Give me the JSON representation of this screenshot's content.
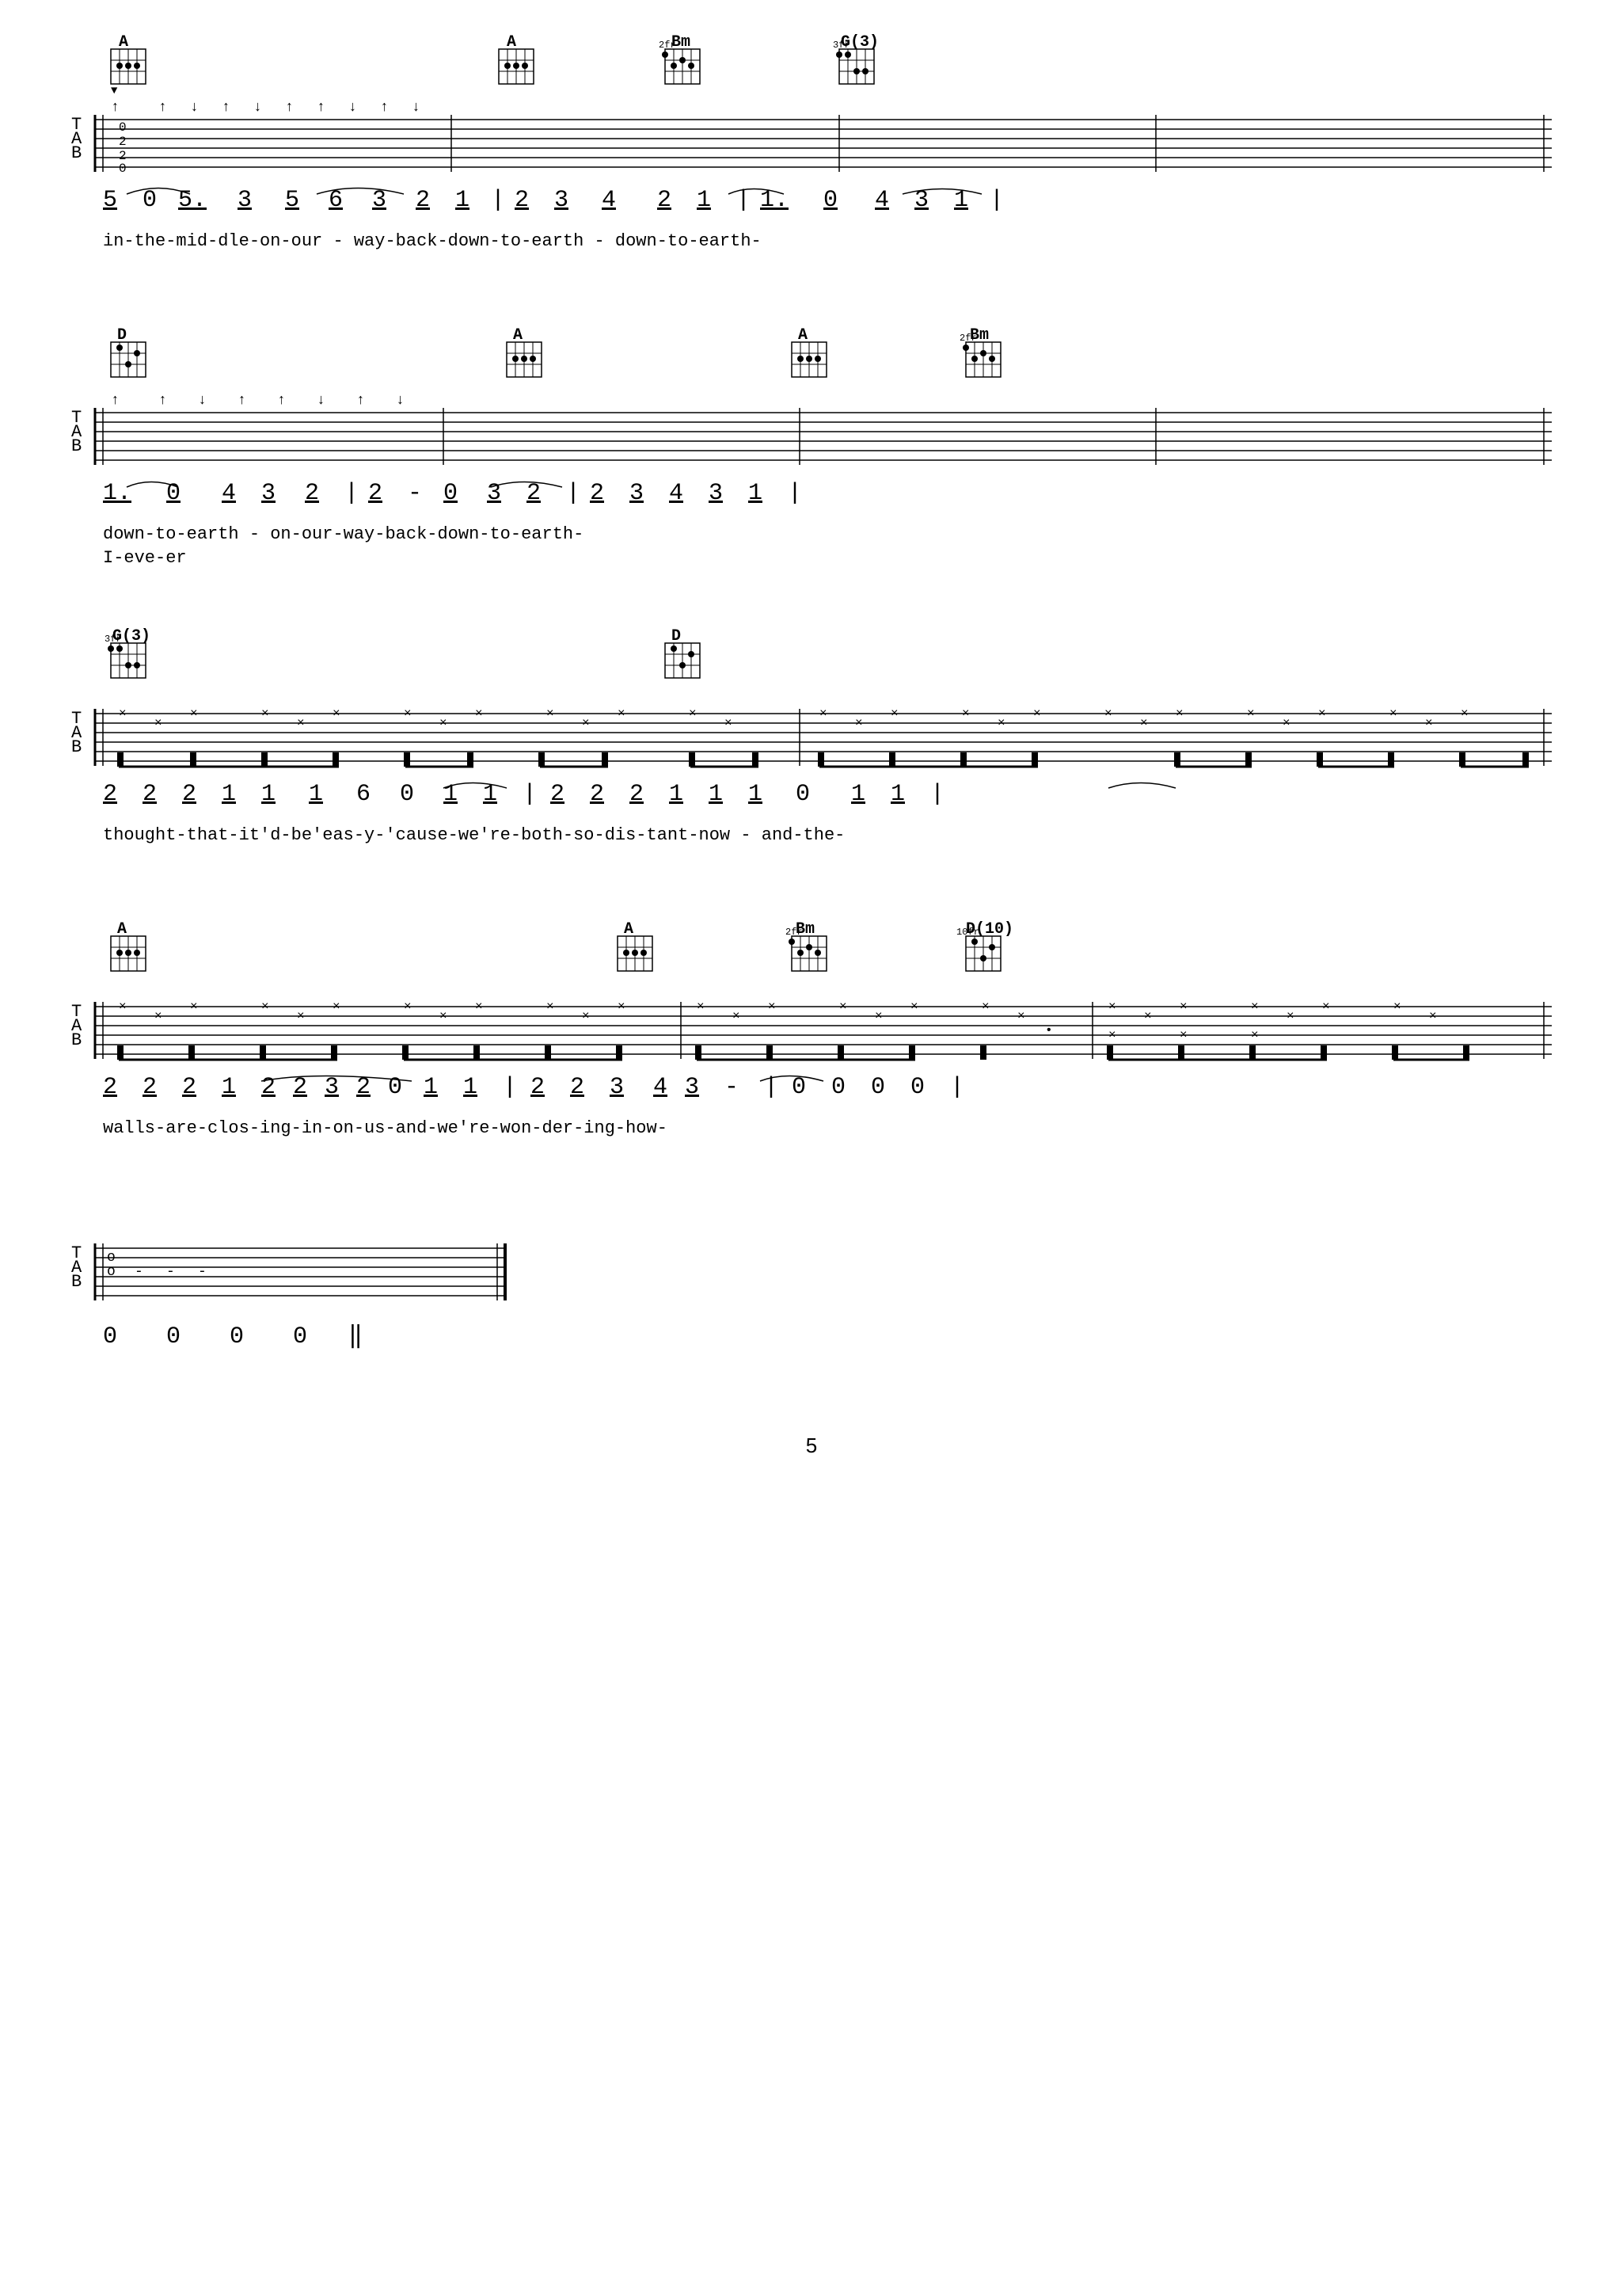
{
  "page": {
    "number": "5",
    "background": "#ffffff"
  },
  "sections": [
    {
      "id": "section1",
      "chords": [
        {
          "name": "A",
          "position": 60,
          "fret": 0
        },
        {
          "name": "A",
          "position": 550,
          "fret": 0
        },
        {
          "name": "Bm",
          "position": 760,
          "fret": 0
        },
        {
          "name": "G(3)",
          "position": 980,
          "fret": 3
        }
      ],
      "notes": "5̣ 0 5.̣  3̣  5̣  6̣  3̣  2̣  1̣  |  2̣  3̣   4̣  2̣  1̣  | 1̣.   0̣  4̣  3̣  1̣  |",
      "notes_raw": [
        "5",
        "0",
        "5.",
        "3",
        "5",
        "6",
        "3",
        "2",
        "1",
        "|",
        "2",
        "3",
        "4",
        "2",
        "1",
        "|",
        "1.",
        "0",
        "4",
        "3",
        "1",
        "|"
      ],
      "lyrics": "in-the-mid-dle-on-our - way-back-down-to-earth - down-to-earth-"
    },
    {
      "id": "section2",
      "chords": [
        {
          "name": "D",
          "position": 60,
          "fret": 0
        },
        {
          "name": "A",
          "position": 560,
          "fret": 0
        },
        {
          "name": "A",
          "position": 920,
          "fret": 0
        },
        {
          "name": "Bm",
          "position": 1130,
          "fret": 0
        }
      ],
      "notes": "1̣.   0̣  4̣  3̣  2̣  |  2̣  -  0̣  3̣  2̣  |  2̣  3̣  4̣  3̣  1̣  |",
      "notes_raw": [
        "1.",
        "0",
        "4",
        "3",
        "2",
        "|",
        "2",
        "-",
        "0",
        "3",
        "2",
        "|",
        "2",
        "3",
        "4",
        "3",
        "1",
        "|"
      ],
      "lyrics": "down-to-earth - on-our-way-back-down-to-earth-",
      "lyrics2": "I-eve-er"
    },
    {
      "id": "section3",
      "chords": [
        {
          "name": "G(3)",
          "position": 60,
          "fret": 3
        },
        {
          "name": "D",
          "position": 760,
          "fret": 0
        }
      ],
      "notes": "2̣  2̣  2̣  1̣  1̣  1̣  6  0  1̣  1̣  |  2̣  2̣  2̣  1̣  1̣  1̣   0  1̣  1̣  |",
      "notes_raw": [
        "2",
        "2",
        "2",
        "1",
        "1",
        "1",
        "6",
        "0",
        "1",
        "1",
        "|",
        "2",
        "2",
        "2",
        "1",
        "1",
        "1",
        "0",
        "1",
        "1",
        "|"
      ],
      "lyrics": "thought-that-it'd-be'eas-y-'cause-we're-both-so-dis-tant-now - and-the-"
    },
    {
      "id": "section4",
      "chords": [
        {
          "name": "A",
          "position": 60,
          "fret": 0
        },
        {
          "name": "A",
          "position": 700,
          "fret": 0
        },
        {
          "name": "Bm",
          "position": 920,
          "fret": 0
        },
        {
          "name": "D(10)",
          "position": 1140,
          "fret": 10
        }
      ],
      "notes": "2̣  2̣  2̣  1̣  2̣2̣3̣2̣0  1̣  1̣  |  2̣  2̣  3̣  4̣3̣  -  |  0  0  0  0  |",
      "notes_raw": [
        "2",
        "2",
        "2",
        "1",
        "2",
        "2",
        "3",
        "2",
        "0",
        "1",
        "1",
        "|",
        "2",
        "2",
        "3",
        "4",
        "3",
        "-",
        "|",
        "0",
        "0",
        "0",
        "0",
        "|"
      ],
      "lyrics": "walls-are-clos-ing-in-on-us-and-we're-won-der-ing-how-"
    },
    {
      "id": "section5",
      "notes_raw": [
        "0",
        "0",
        "0",
        "0"
      ],
      "final": true
    }
  ],
  "labels": {
    "T": "T",
    "A": "A",
    "B": "B"
  }
}
